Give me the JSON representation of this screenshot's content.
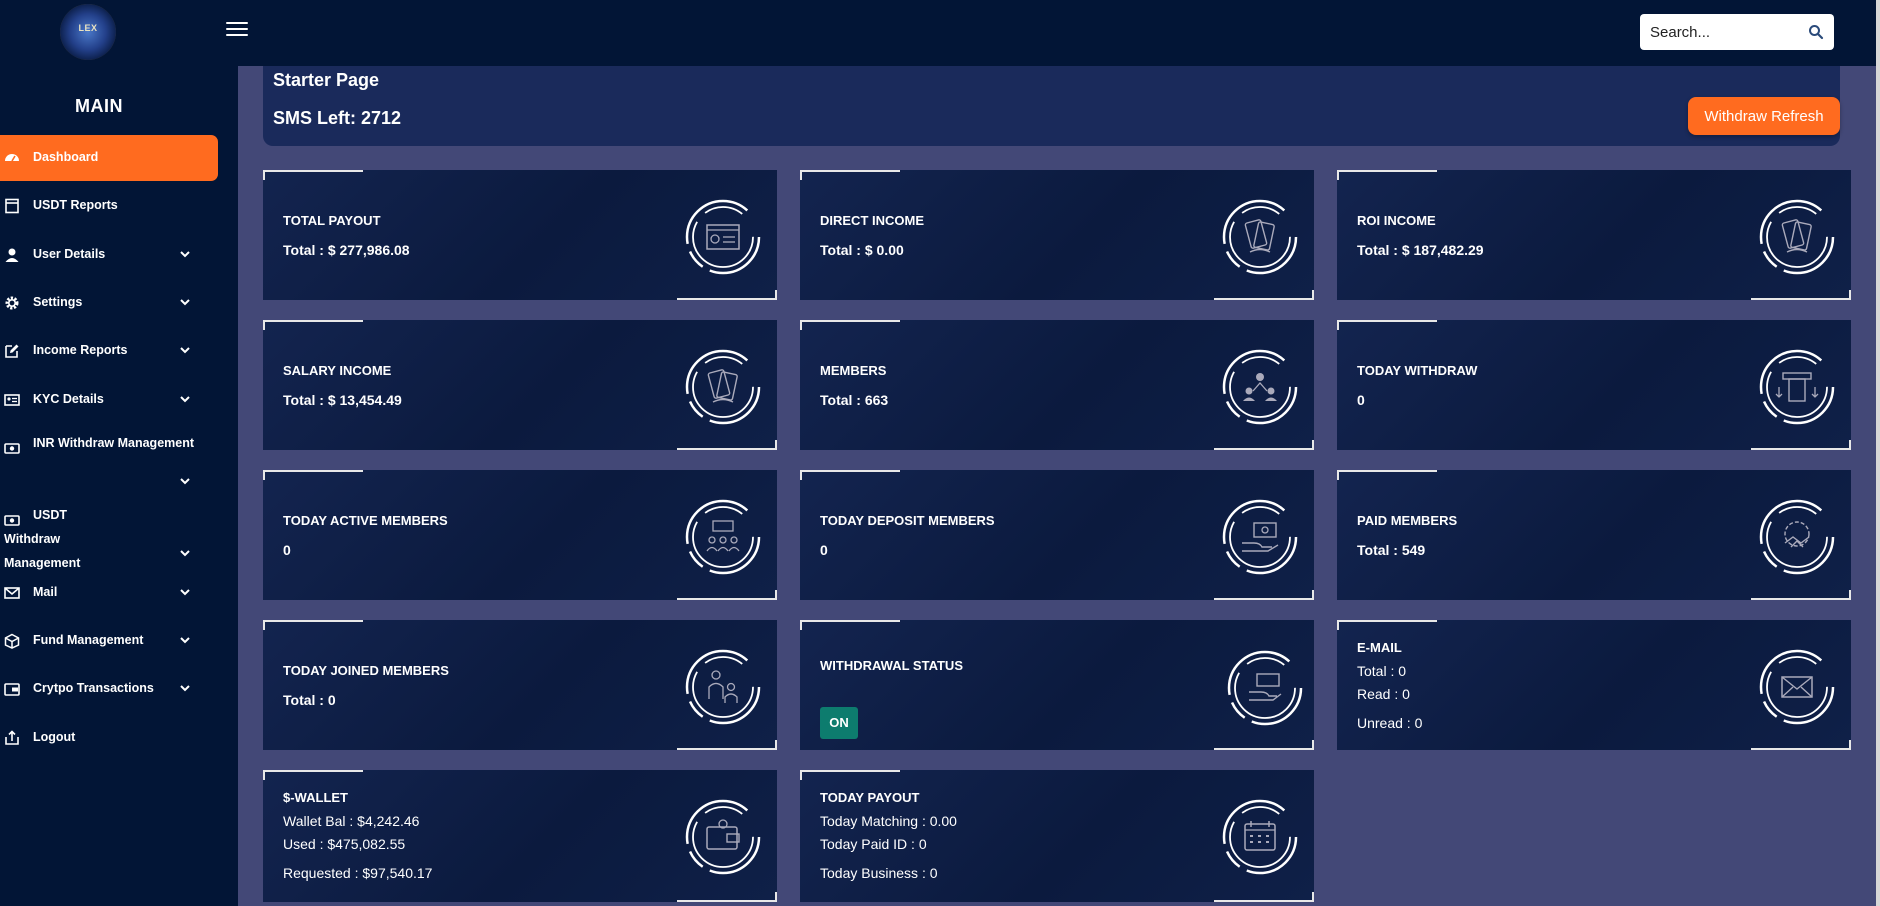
{
  "logo": {
    "text": "LEX"
  },
  "search": {
    "placeholder": "Search..."
  },
  "sidebar": {
    "title": "MAIN",
    "items": [
      {
        "label": "Dashboard",
        "icon": "dashboard-icon",
        "active": true
      },
      {
        "label": "USDT Reports",
        "icon": "document-icon"
      },
      {
        "label": "User Details",
        "icon": "user-icon"
      },
      {
        "label": "Settings",
        "icon": "gear-icon"
      },
      {
        "label": "Income Reports",
        "icon": "edit-icon"
      },
      {
        "label": "KYC Details",
        "icon": "id-card-icon"
      },
      {
        "label": "INR Withdraw Management",
        "icon": "cash-icon"
      },
      {
        "label": "USDT Withdraw Management",
        "icon": "cash-icon"
      },
      {
        "label": "Mail",
        "icon": "mail-icon"
      },
      {
        "label": "Fund Management",
        "icon": "box-icon"
      },
      {
        "label": "Crytpo Transactions",
        "icon": "wallet-icon"
      },
      {
        "label": "Logout",
        "icon": "logout-icon"
      }
    ]
  },
  "header": {
    "title": "Starter Page",
    "sms_left": "SMS Left: 2712",
    "refresh_button": "Withdraw Refresh"
  },
  "cards": {
    "total_payout": {
      "title": "TOTAL PAYOUT",
      "line1": "Total : $ 277,986.08"
    },
    "direct_income": {
      "title": "DIRECT INCOME",
      "line1": "Total : $ 0.00"
    },
    "roi_income": {
      "title": "ROI INCOME",
      "line1": "Total : $ 187,482.29"
    },
    "salary_income": {
      "title": "SALARY INCOME",
      "line1": "Total : $ 13,454.49"
    },
    "members": {
      "title": "MEMBERS",
      "line1": "Total : 663"
    },
    "today_withdraw": {
      "title": "TODAY WITHDRAW",
      "line1": "0"
    },
    "today_active_members": {
      "title": "TODAY ACTIVE MEMBERS",
      "line1": "0"
    },
    "today_deposit_members": {
      "title": "TODAY DEPOSIT MEMBERS",
      "line1": "0"
    },
    "paid_members": {
      "title": "PAID MEMBERS",
      "line1": "Total : 549"
    },
    "today_joined_members": {
      "title": "TODAY JOINED MEMBERS",
      "line1": "Total : 0"
    },
    "withdrawal_status": {
      "title": "WITHDRAWAL STATUS",
      "badge": "ON"
    },
    "email": {
      "title": "E-MAIL",
      "line1": "Total : 0",
      "line2": "Read : 0",
      "line3": "Unread : 0"
    },
    "wallet": {
      "title": "$-WALLET",
      "line1": "Wallet Bal : $4,242.46",
      "line2": "Used : $475,082.55",
      "line3": "Requested : $97,540.17"
    },
    "today_payout": {
      "title": "TODAY PAYOUT",
      "line1": "Today Matching : 0.00",
      "line2": "Today Paid ID : 0",
      "line3": "Today Business : 0"
    }
  },
  "colors": {
    "background": "#434877",
    "sidebar": "#021536",
    "accent": "#ff6b1f",
    "card": "#0b1a3e",
    "badge_on": "#0d7c6e"
  }
}
